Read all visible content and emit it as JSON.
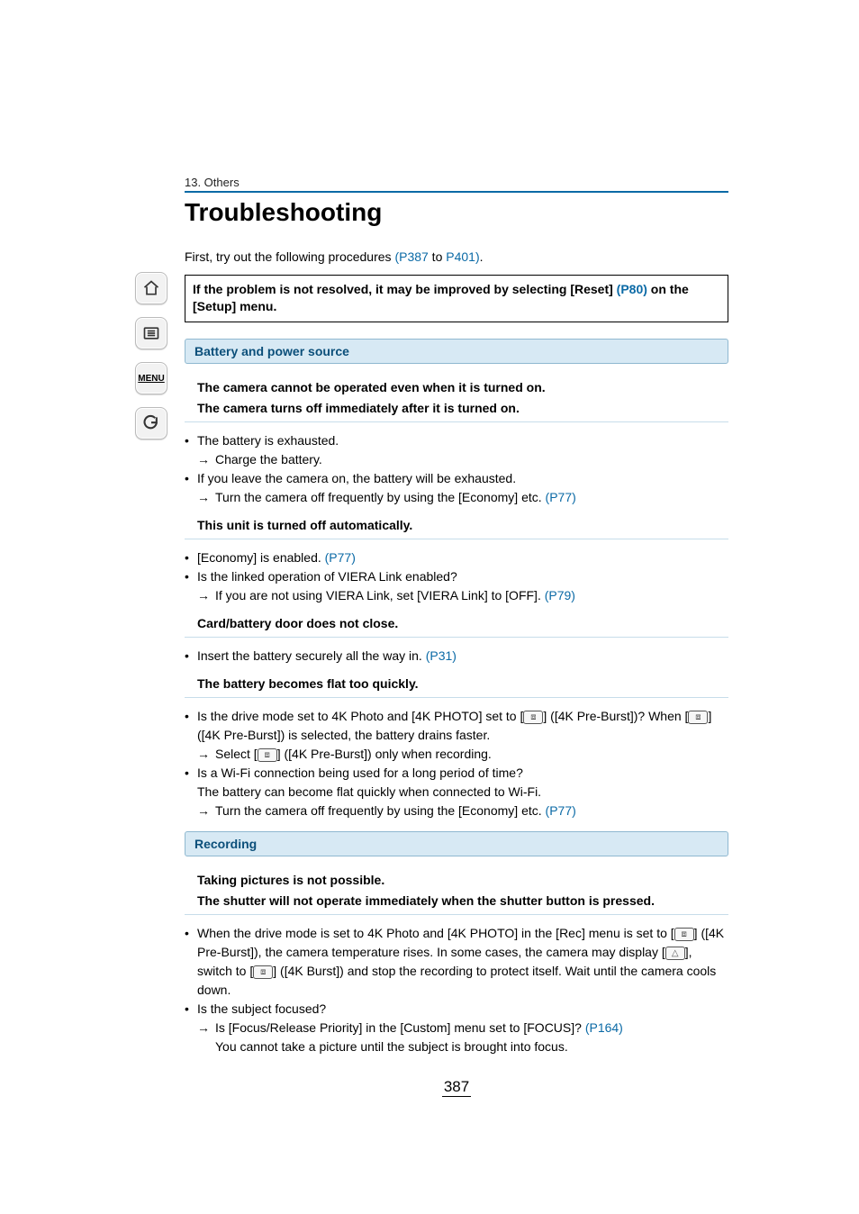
{
  "section_label": "13. Others",
  "title": "Troubleshooting",
  "intro": {
    "pre": "First, try out the following procedures ",
    "link1": "(P387",
    "mid": " to ",
    "link2": "P401)",
    "post": "."
  },
  "reset_box": {
    "pre": "If the problem is not resolved, it may be improved by selecting [Reset] ",
    "link": "(P80)",
    "post": " on the [Setup] menu."
  },
  "sidebar": {
    "menu_label": "MENU"
  },
  "sections": {
    "battery": {
      "heading": "Battery and power source",
      "issue1_line1": "The camera cannot be operated even when it is turned on.",
      "issue1_line2": "The camera turns off immediately after it is turned on.",
      "b1_1": "The battery is exhausted.",
      "b1_1a": "Charge the battery.",
      "b1_2": "If you leave the camera on, the battery will be exhausted.",
      "b1_2a_pre": "Turn the camera off frequently by using the [Economy] etc. ",
      "b1_2a_link": "(P77)",
      "issue2": "This unit is turned off automatically.",
      "b2_1_pre": "[Economy] is enabled. ",
      "b2_1_link": "(P77)",
      "b2_2": "Is the linked operation of VIERA Link enabled?",
      "b2_2a_pre": "If you are not using VIERA Link, set [VIERA Link] to [OFF]. ",
      "b2_2a_link": "(P79)",
      "issue3": "Card/battery door does not close.",
      "b3_1_pre": "Insert the battery securely all the way in. ",
      "b3_1_link": "(P31)",
      "issue4": "The battery becomes flat too quickly.",
      "b4_1_pre": "Is the drive mode set to 4K Photo and [4K PHOTO] set to [",
      "b4_1_mid": "] ([4K Pre-Burst])? When [",
      "b4_1_post": "] ([4K Pre-Burst]) is selected, the battery drains faster.",
      "b4_1a_pre": "Select [",
      "b4_1a_post": "] ([4K Pre-Burst]) only when recording.",
      "b4_2": "Is a Wi-Fi connection being used for a long period of time?",
      "b4_2_sub": "The battery can become flat quickly when connected to Wi-Fi.",
      "b4_2a_pre": "Turn the camera off frequently by using the [Economy] etc. ",
      "b4_2a_link": "(P77)"
    },
    "recording": {
      "heading": "Recording",
      "issue1_line1": "Taking pictures is not possible.",
      "issue1_line2": "The shutter will not operate immediately when the shutter button is pressed.",
      "b1_pre": "When the drive mode is set to 4K Photo and [4K PHOTO] in the [Rec] menu is set to [",
      "b1_mid1": "] ([4K Pre-Burst]), the camera temperature rises. In some cases, the camera may display [",
      "b1_mid2": "], switch to [",
      "b1_post": "] ([4K Burst]) and stop the recording to protect itself. Wait until the camera cools down.",
      "b2": "Is the subject focused?",
      "b2a_pre": "Is [Focus/Release Priority] in the [Custom] menu set to [FOCUS]? ",
      "b2a_link": "(P164)",
      "b2a_sub": "You cannot take a picture until the subject is brought into focus."
    }
  },
  "page_number": "387"
}
